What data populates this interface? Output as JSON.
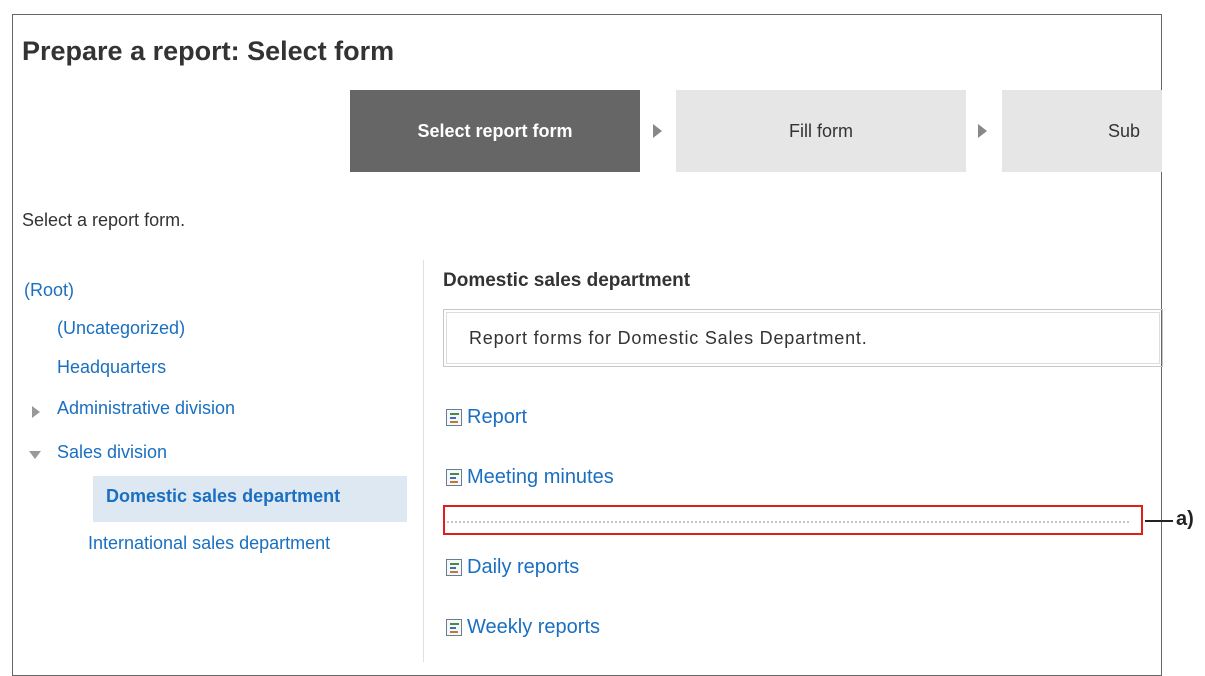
{
  "header": {
    "title": "Prepare a report: Select form"
  },
  "steps": [
    {
      "label": "Select report form",
      "state": "active"
    },
    {
      "label": "Fill form",
      "state": "inactive"
    },
    {
      "label": "Sub",
      "state": "inactive"
    }
  ],
  "instruction": "Select a report form.",
  "tree": {
    "root": "(Root)",
    "items": [
      {
        "label": "(Uncategorized)",
        "toggle": "none"
      },
      {
        "label": "Headquarters",
        "toggle": "none"
      },
      {
        "label": "Administrative division",
        "toggle": "collapsed"
      },
      {
        "label": "Sales division",
        "toggle": "expanded"
      },
      {
        "label": "Domestic sales department",
        "selected": true
      },
      {
        "label": "International sales department"
      }
    ]
  },
  "folder": {
    "title": "Domestic sales department",
    "description": "Report forms for Domestic Sales Department."
  },
  "forms": [
    {
      "label": "Report",
      "icon": "report-form-icon"
    },
    {
      "label": "Meeting minutes",
      "icon": "report-form-icon"
    },
    {
      "label": "Daily reports",
      "icon": "report-form-icon"
    },
    {
      "label": "Weekly reports",
      "icon": "report-form-icon"
    }
  ],
  "annotation": {
    "label": "a)",
    "color": "#e01e1e"
  },
  "colors": {
    "link": "#1a6fc0",
    "active_step": "#666666",
    "inactive_step": "#e6e6e6",
    "selected_bg": "#dde8f3"
  }
}
